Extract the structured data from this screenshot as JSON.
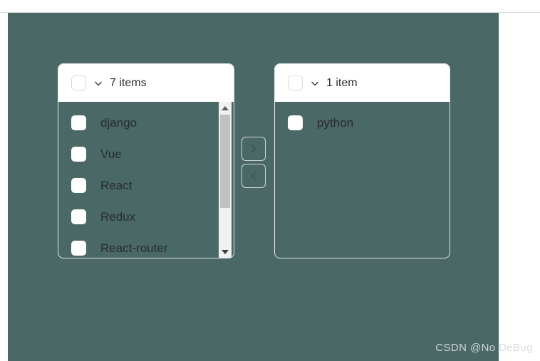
{
  "page": {
    "background_color": "#ffffff",
    "stage_color": "#4a6866"
  },
  "transfer": {
    "source_panel": {
      "header": {
        "chevron_icon": "chevron-down-icon",
        "count_label": "7 items",
        "select_all_checkbox_checked": false
      },
      "items": [
        {
          "label": "django",
          "checked": false
        },
        {
          "label": "Vue",
          "checked": false
        },
        {
          "label": "React",
          "checked": false
        },
        {
          "label": "Redux",
          "checked": false
        },
        {
          "label": "React-router",
          "checked": false
        }
      ],
      "scrollbar": {
        "up_arrow_icon": "triangle-up-icon",
        "down_arrow_icon": "triangle-down-icon",
        "thumb_visible": true
      }
    },
    "target_panel": {
      "header": {
        "chevron_icon": "chevron-down-icon",
        "count_label": "1 item",
        "select_all_checkbox_checked": false
      },
      "items": [
        {
          "label": "python",
          "checked": false
        }
      ]
    },
    "buttons": {
      "move_right": {
        "icon": "chevron-right-icon",
        "label": ">"
      },
      "move_left": {
        "icon": "chevron-left-icon",
        "label": "<"
      }
    }
  },
  "watermark": {
    "text": "CSDN @No",
    "tail": " DeBug"
  }
}
